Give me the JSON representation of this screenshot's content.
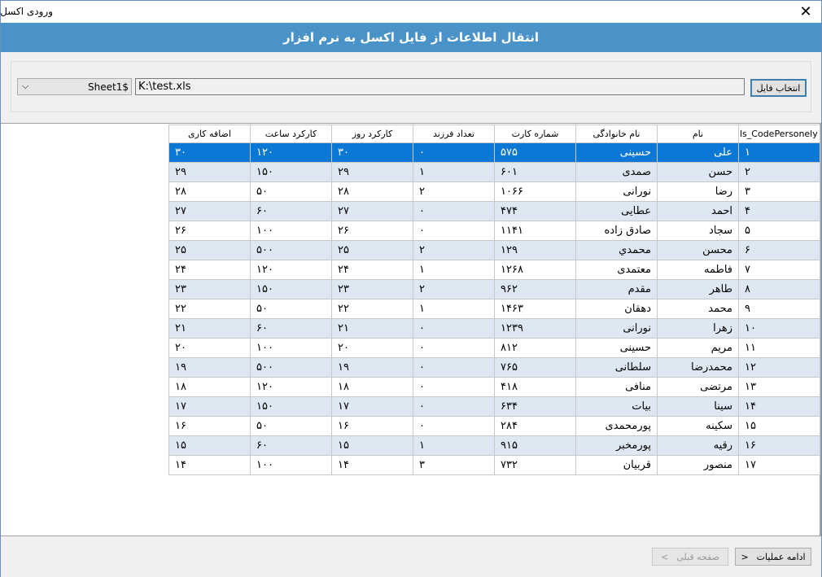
{
  "window": {
    "title": "ورودی اکسل",
    "close_glyph": "✕"
  },
  "banner": {
    "text": "انتقال اطلاعات از فایل اکسل به نرم افزار"
  },
  "file": {
    "sheet_value": "Sheet1$",
    "sheet_arrow": "⌵",
    "path_value": "K:\\test.xls",
    "select_button_label": "انتخاب فایل"
  },
  "grid": {
    "columns": [
      "ls_CodePersonely",
      "نام",
      "نام خانوادگی",
      "شماره کارت",
      "تعداد فرزند",
      "کارکرد روز",
      "کارکرد ساعت",
      "اضافه کاری"
    ],
    "rows": [
      [
        "۱",
        "علی",
        "حسینی",
        "۵۷۵",
        "۰",
        "۳۰",
        "۱۲۰",
        "۳۰"
      ],
      [
        "۲",
        "حسن",
        "صمدی",
        "۶۰۱",
        "۱",
        "۲۹",
        "۱۵۰",
        "۲۹"
      ],
      [
        "۳",
        "رضا",
        "نورانی",
        "۱۰۶۶",
        "۲",
        "۲۸",
        "۵۰",
        "۲۸"
      ],
      [
        "۴",
        "احمد",
        "عطایی",
        "۴۷۴",
        "۰",
        "۲۷",
        "۶۰",
        "۲۷"
      ],
      [
        "۵",
        "سجاد",
        "صادق زاده",
        "۱۱۴۱",
        "۰",
        "۲۶",
        "۱۰۰",
        "۲۶"
      ],
      [
        "۶",
        "محسن",
        "محمدي",
        "۱۲۹",
        "۲",
        "۲۵",
        "۵۰۰",
        "۲۵"
      ],
      [
        "۷",
        "فاطمه",
        "معتمدی",
        "۱۲۶۸",
        "۱",
        "۲۴",
        "۱۲۰",
        "۲۴"
      ],
      [
        "۸",
        "طاهر",
        "مقدم",
        "۹۶۲",
        "۲",
        "۲۳",
        "۱۵۰",
        "۲۳"
      ],
      [
        "۹",
        "محمد",
        "دهقان",
        "۱۴۶۳",
        "۱",
        "۲۲",
        "۵۰",
        "۲۲"
      ],
      [
        "۱۰",
        "زهرا",
        "نورانی",
        "۱۲۳۹",
        "۰",
        "۲۱",
        "۶۰",
        "۲۱"
      ],
      [
        "۱۱",
        "مریم",
        "حسینی",
        "۸۱۲",
        "۰",
        "۲۰",
        "۱۰۰",
        "۲۰"
      ],
      [
        "۱۲",
        "محمدرضا",
        "سلطانی",
        "۷۶۵",
        "۰",
        "۱۹",
        "۵۰۰",
        "۱۹"
      ],
      [
        "۱۳",
        "مرتضی",
        "منافی",
        "۴۱۸",
        "۰",
        "۱۸",
        "۱۲۰",
        "۱۸"
      ],
      [
        "۱۴",
        "سینا",
        "بیات",
        "۶۳۴",
        "۰",
        "۱۷",
        "۱۵۰",
        "۱۷"
      ],
      [
        "۱۵",
        "سکینه",
        "پورمحمدی",
        "۲۸۴",
        "۰",
        "۱۶",
        "۵۰",
        "۱۶"
      ],
      [
        "۱۶",
        "رقیه",
        "پورمخبر",
        "۹۱۵",
        "۱",
        "۱۵",
        "۶۰",
        "۱۵"
      ],
      [
        "۱۷",
        "منصور",
        "قربیان",
        "۷۳۲",
        "۳",
        "۱۴",
        "۱۰۰",
        "۱۴"
      ]
    ],
    "selected_row": 0
  },
  "footer": {
    "continue_label": "ادامه عملیات",
    "continue_glyph": "<",
    "prev_label": "صفحه قبلی",
    "prev_glyph": ">"
  },
  "colors": {
    "banner": "#4a93c8",
    "selection": "#0c78d6",
    "alt_row": "#dde8f3"
  }
}
